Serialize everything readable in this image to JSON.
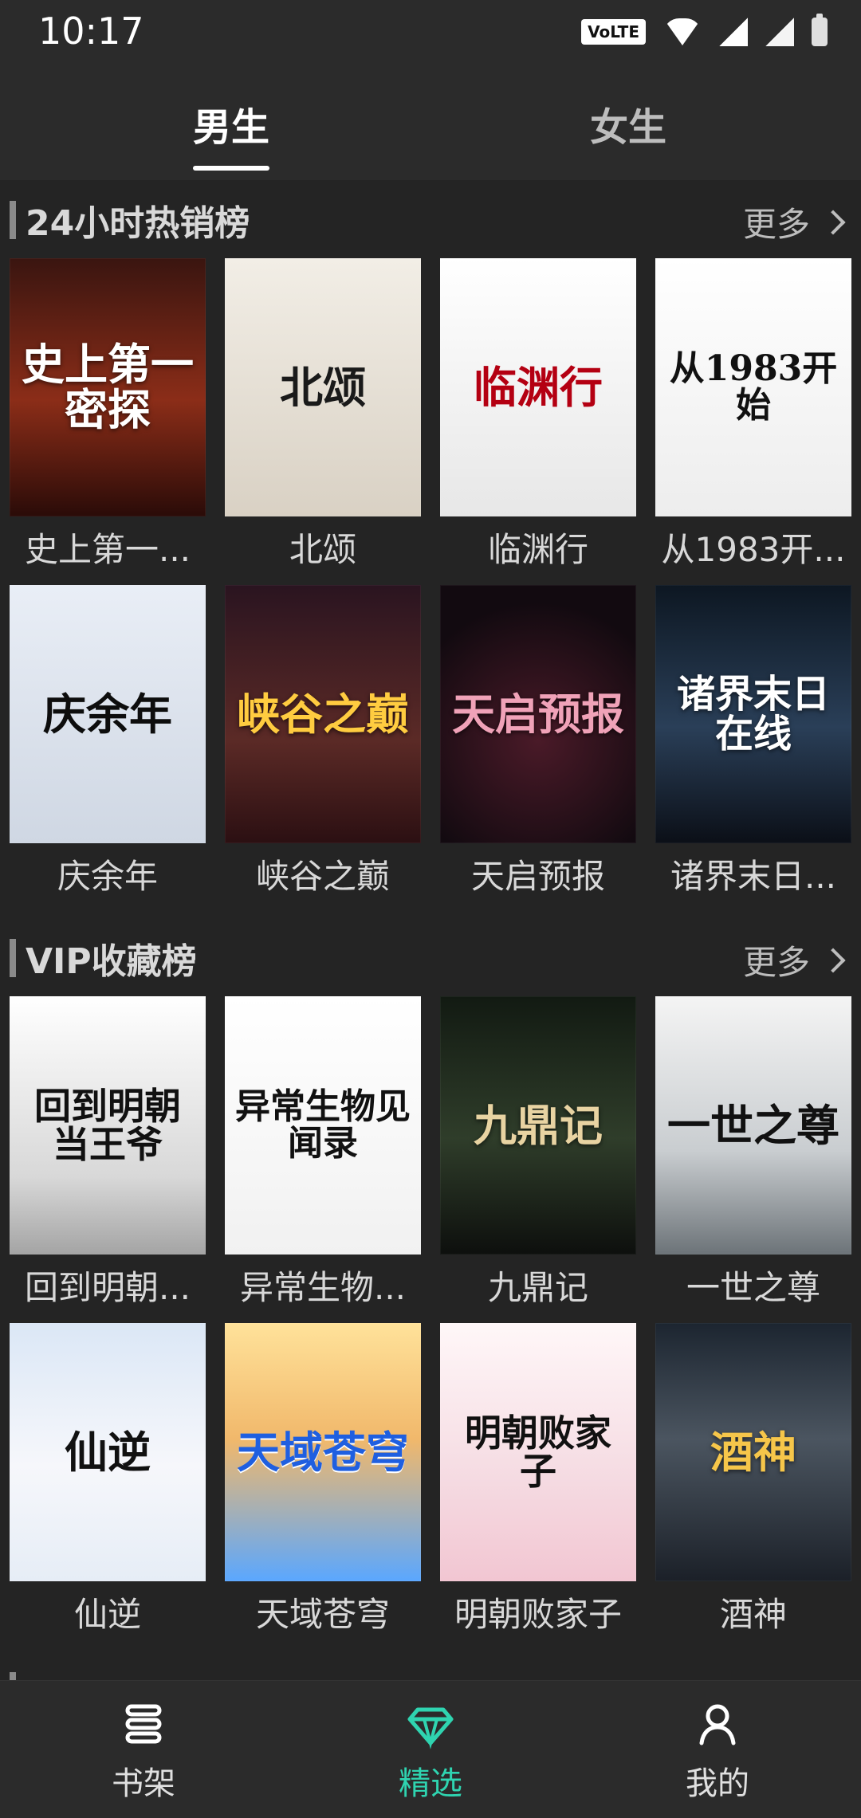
{
  "status_bar": {
    "time": "10:17",
    "volte": "VoLTE"
  },
  "tabs": [
    {
      "label": "男生",
      "active": true
    },
    {
      "label": "女生",
      "active": false
    }
  ],
  "sections": [
    {
      "title": "24小时热销榜",
      "more_label": "更多",
      "books": [
        {
          "title": "史上第一...",
          "cover_text": "史上第一密探",
          "cover_bg": "#6b1d12"
        },
        {
          "title": "北颂",
          "cover_text": "北颂",
          "cover_bg": "#e6e0d6"
        },
        {
          "title": "临渊行",
          "cover_text": "临渊行",
          "cover_bg": "#f2f2f2"
        },
        {
          "title": "从1983开...",
          "cover_text": "从1983开始",
          "cover_bg": "#f3f3f3"
        },
        {
          "title": "庆余年",
          "cover_text": "庆余年",
          "cover_bg": "#dfe6f0"
        },
        {
          "title": "峡谷之巅",
          "cover_text": "峡谷之巅",
          "cover_bg": "#3b1b26"
        },
        {
          "title": "天启预报",
          "cover_text": "天启预报",
          "cover_bg": "#1a0f14"
        },
        {
          "title": "诸界末日...",
          "cover_text": "诸界末日在线",
          "cover_bg": "#1c2a3a"
        }
      ]
    },
    {
      "title": "VIP收藏榜",
      "more_label": "更多",
      "books": [
        {
          "title": "回到明朝...",
          "cover_text": "回到明朝当王爷",
          "cover_bg": "#f1f1f1"
        },
        {
          "title": "异常生物...",
          "cover_text": "异常生物见闻录",
          "cover_bg": "#fafafa"
        },
        {
          "title": "九鼎记",
          "cover_text": "九鼎记",
          "cover_bg": "#2d3a2a"
        },
        {
          "title": "一世之尊",
          "cover_text": "一世之尊",
          "cover_bg": "#cfd4d6"
        },
        {
          "title": "仙逆",
          "cover_text": "仙逆",
          "cover_bg": "#eef2f7"
        },
        {
          "title": "天域苍穹",
          "cover_text": "天域苍穹",
          "cover_bg": "#f0c86a"
        },
        {
          "title": "明朝败家子",
          "cover_text": "明朝败家子",
          "cover_bg": "#f6e6ea"
        },
        {
          "title": "酒神",
          "cover_text": "酒神",
          "cover_bg": "#2a2f3a"
        }
      ]
    }
  ],
  "bottom_nav": [
    {
      "label": "书架",
      "icon": "bookshelf-icon",
      "active": false
    },
    {
      "label": "精选",
      "icon": "diamond-icon",
      "active": true
    },
    {
      "label": "我的",
      "icon": "user-icon",
      "active": false
    }
  ],
  "accent_color": "#2fd4b0"
}
